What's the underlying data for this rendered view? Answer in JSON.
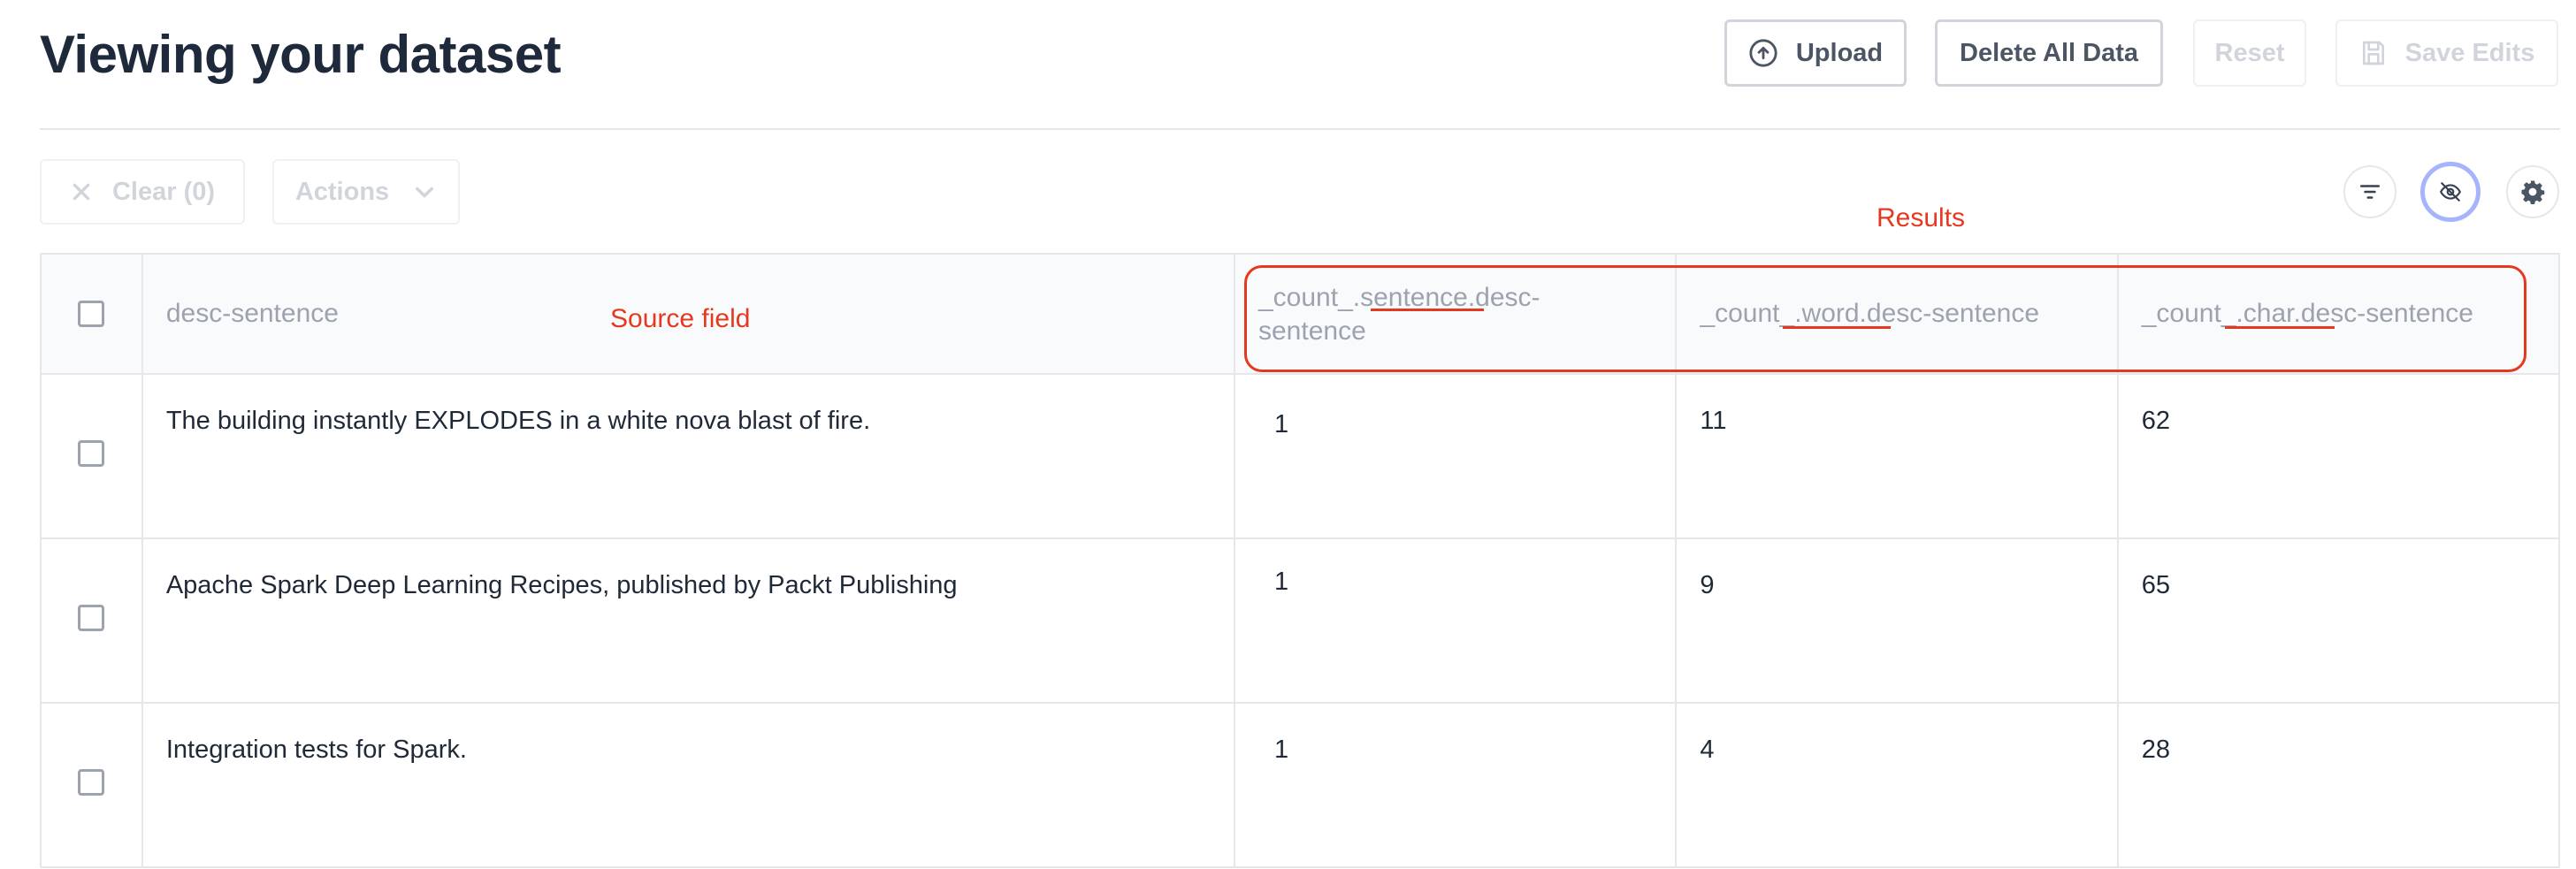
{
  "header": {
    "title": "Viewing your dataset",
    "upload_label": "Upload",
    "delete_label": "Delete All Data",
    "reset_label": "Reset",
    "save_label": "Save Edits"
  },
  "toolbar": {
    "clear_label": "Clear (0)",
    "actions_label": "Actions"
  },
  "annotations": {
    "results": "Results",
    "source": "Source field"
  },
  "table": {
    "columns": [
      "desc-sentence",
      "_count_.sentence.desc-sentence",
      "_count_.word.desc-sentence",
      "_count_.char.desc-sentence"
    ],
    "rows": [
      [
        "The building instantly EXPLODES in a white nova blast of fire.",
        "1",
        "11",
        "62"
      ],
      [
        "Apache Spark Deep Learning Recipes, published by Packt Publishing",
        "1",
        "9",
        "65"
      ],
      [
        "Integration tests for Spark.",
        "1",
        "4",
        "28"
      ]
    ]
  },
  "colors": {
    "annotation": "#e5391f",
    "title": "#1e293b",
    "muted_text": "#9ca3af",
    "border": "#e5e7eb",
    "hide_ring": "#a5b4fc"
  },
  "icons": [
    "upload-icon",
    "save-icon",
    "close-icon",
    "chevron-down-icon",
    "filter-icon",
    "eye-off-icon",
    "gear-icon"
  ]
}
